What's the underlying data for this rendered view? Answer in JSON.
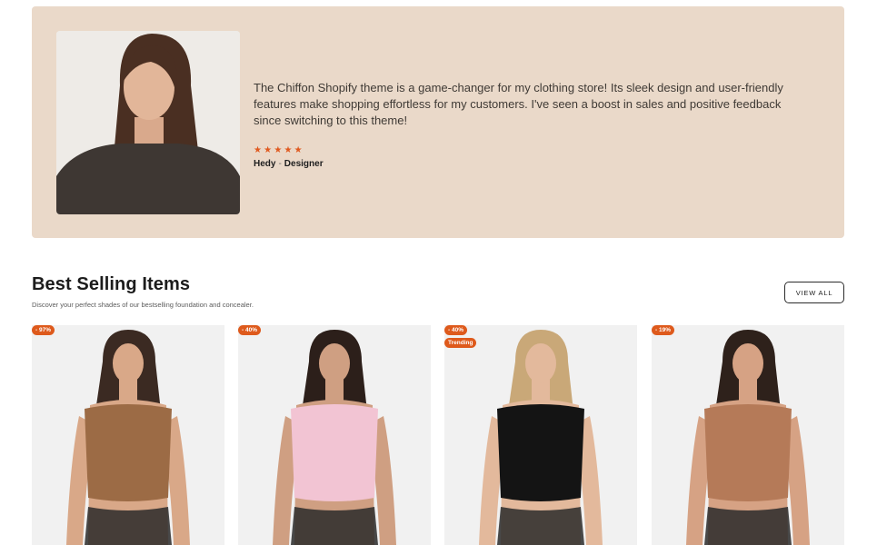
{
  "testimonial": {
    "quote": "The Chiffon Shopify theme is a game-changer for my clothing store! Its sleek design and user-friendly features make shopping effortless for my customers. I've seen a boost in sales and positive feedback since switching to this theme!",
    "stars": "★★★★★",
    "rating": 5,
    "author_name": "Hedy",
    "author_separator": "-",
    "author_role": "Designer"
  },
  "section": {
    "title": "Best Selling Items",
    "subtitle": "Discover your perfect shades of our bestselling foundation and concealer.",
    "view_all_label": "VIEW ALL"
  },
  "products": [
    {
      "discount": "- 97%",
      "extra_badge": "",
      "top_color": "#9c6b45",
      "skin": "#d9a888",
      "hair": "#3b2a22"
    },
    {
      "discount": "- 40%",
      "extra_badge": "",
      "top_color": "#f2c4d3",
      "skin": "#cf9f82",
      "hair": "#2c1f1a"
    },
    {
      "discount": "- 40%",
      "extra_badge": "Trending",
      "top_color": "#141414",
      "skin": "#e3b99c",
      "hair": "#c9a878"
    },
    {
      "discount": "- 19%",
      "extra_badge": "",
      "top_color": "#b57a58",
      "skin": "#d6a284",
      "hair": "#2e211b"
    }
  ],
  "colors": {
    "testimonial_bg": "#ead9c9",
    "accent": "#de5a1c",
    "star": "#e0591f"
  }
}
